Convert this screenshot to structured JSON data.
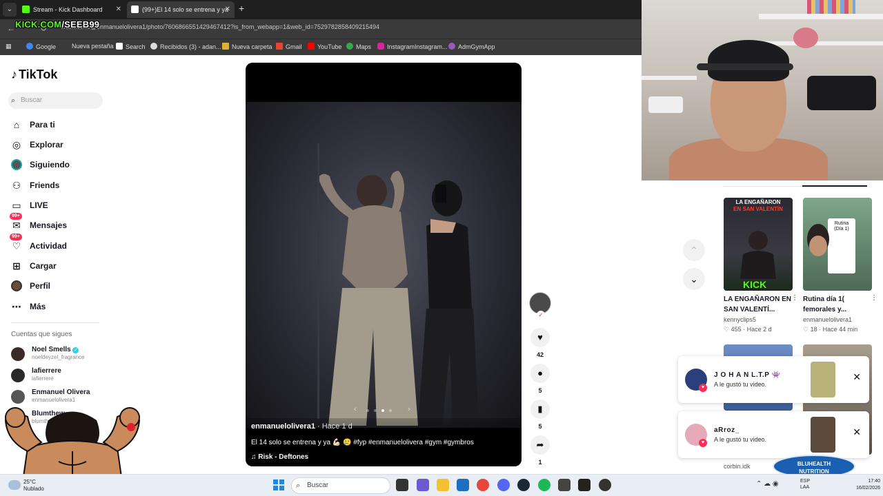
{
  "browser": {
    "tabs": [
      {
        "label": "Stream - Kick Dashboard",
        "favicon_color": "#53fc18"
      },
      {
        "label": "(99+)El 14 solo se entrena y ya",
        "favicon_color": "#ffffff"
      }
    ],
    "url": "tiktok.com/@enmanuelolivera1/photo/7606866551429467412?is_from_webapp=1&web_id=7529782858409215494",
    "bookmarks": [
      {
        "label": "Google",
        "color": "#4285f4"
      },
      {
        "label": "Nueva pestaña",
        "color": "#777777"
      },
      {
        "label": "Search",
        "color": "#ffffff"
      },
      {
        "label": "Recibidos (3) - adan...",
        "color": "#dddddd"
      },
      {
        "label": "Nueva carpeta",
        "color": "#e0b030"
      },
      {
        "label": "Gmail",
        "color": "#ea4335"
      },
      {
        "label": "YouTube",
        "color": "#ff0000"
      },
      {
        "label": "Maps",
        "color": "#34a853"
      },
      {
        "label": "InstagramInstagram...",
        "color": "#d6249f"
      },
      {
        "label": "AdmGymApp",
        "color": "#9b59b6"
      }
    ]
  },
  "overlay": {
    "kick_prefix": "KICK.COM",
    "kick_suffix": "/SEEB99"
  },
  "tiktok": {
    "logo": "TikTok",
    "search_placeholder": "Buscar",
    "nav": [
      {
        "label": "Para ti",
        "icon": "home-icon"
      },
      {
        "label": "Explorar",
        "icon": "compass-icon"
      },
      {
        "label": "Siguiendo",
        "icon": "following-avatar"
      },
      {
        "label": "Friends",
        "icon": "friends-icon"
      },
      {
        "label": "LIVE",
        "icon": "live-icon"
      },
      {
        "label": "Mensajes",
        "icon": "messages-icon",
        "badge": "99+"
      },
      {
        "label": "Actividad",
        "icon": "activity-icon",
        "badge": "99+"
      },
      {
        "label": "Cargar",
        "icon": "upload-icon"
      },
      {
        "label": "Perfil",
        "icon": "profile-avatar"
      },
      {
        "label": "Más",
        "icon": "more-icon"
      }
    ],
    "following_title": "Cuentas que sigues",
    "following": [
      {
        "name": "Noel Smells",
        "handle": "noeldeyzel_fragrance",
        "verified": true
      },
      {
        "name": "lafierrere",
        "handle": "lafierrere",
        "verified": false
      },
      {
        "name": "Enmanuel Olivera",
        "handle": "enmanuelolivera1",
        "verified": false
      },
      {
        "name": "Blumthew",
        "handle": "blumthew",
        "verified": false
      }
    ],
    "video": {
      "author": "enmanuelolivera1",
      "ago": " · Hace 1 d",
      "caption": "El 14 solo se entrena y ya 💪🏻 🥲 #fyp #enmanuelolivera #gym #gymbros",
      "music": "Risk - Deftones",
      "slides_total": 4,
      "slide_active": 3
    },
    "actions": {
      "likes": "42",
      "comments": "5",
      "saves": "5",
      "shares": "1"
    },
    "recommendations": [
      {
        "thumb_title_line1": "LA ENGAÑARON",
        "thumb_title_line2": "EN SAN VALENTÍN",
        "thumb_badge": "KICK",
        "title": "LA ENGAÑARON EN SAN VALENTÍ...",
        "author": "kennyclips5",
        "likes": "455",
        "ago": "Hace 2 d"
      },
      {
        "thumb_label": "Rutina (Día 1)",
        "title": "Rutina día 1( femorales y...",
        "author": "enmanuelolivera1",
        "likes": "18",
        "ago": "Hace 44 min"
      }
    ],
    "corbin": "corbin.idk"
  },
  "notifications": [
    {
      "name": "J O H A N L.T.P 👾",
      "message": "A le gustó tu video.",
      "avatar_color": "#2b3f7a",
      "preview_color": "#b8b27a"
    },
    {
      "name": "aRroz_",
      "message": "A le gustó tu video.",
      "avatar_color": "#e6a9b9",
      "preview_color": "#5c4a3a"
    }
  ],
  "sponsor": {
    "line1": "BLUHEALTH",
    "line2": "NUTRITION"
  },
  "taskbar": {
    "weather_temp": "25°C",
    "weather_desc": "Nublado",
    "search_placeholder": "Buscar",
    "lang1": "ESP",
    "lang2": "LAA",
    "time": "17:40",
    "date": "16/02/2026"
  }
}
